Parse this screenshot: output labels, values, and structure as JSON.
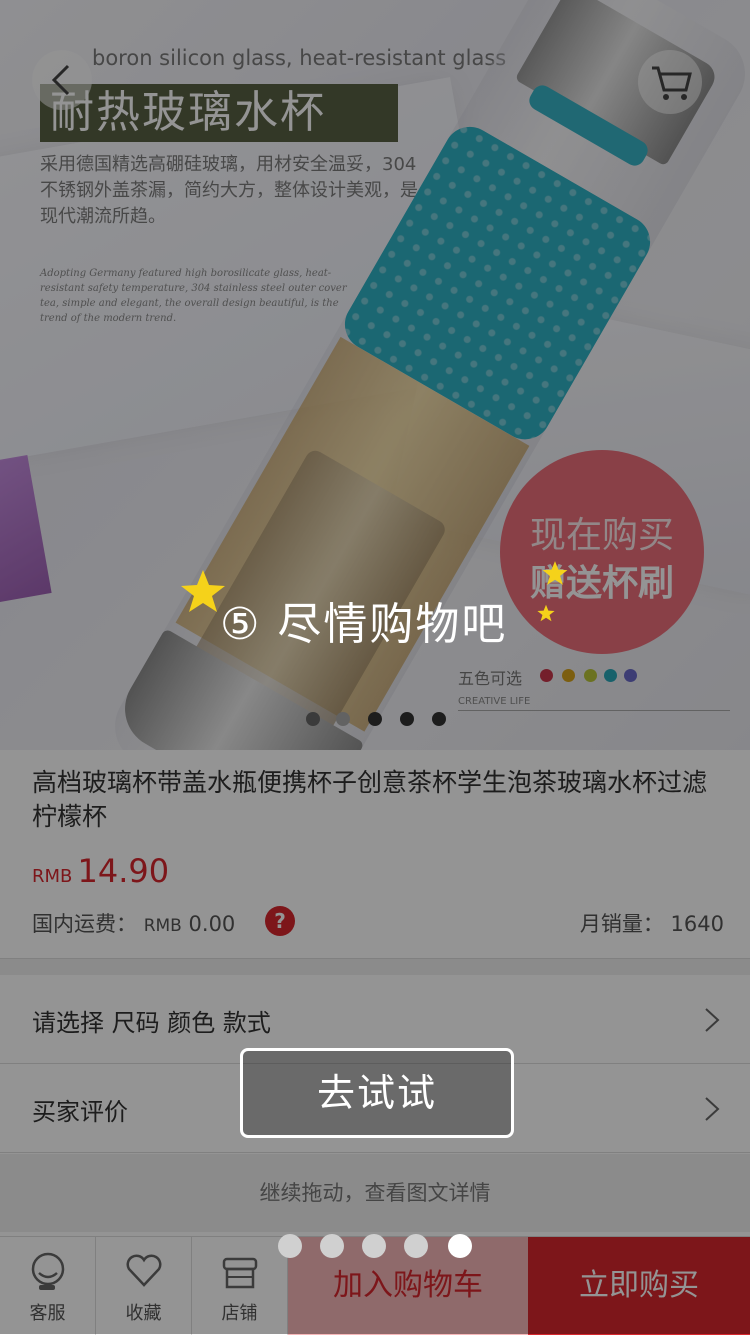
{
  "hero": {
    "en_heading": "boron silicon glass, heat-resistant glass",
    "cn_title": "耐热玻璃水杯",
    "description": "采用德国精选高硼硅玻璃，用材安全温妥，304不锈钢外盖茶漏，简约大方，整体设计美观，是现代潮流所趋。",
    "small_en": "Adopting Germany featured high borosilicate glass, heat-resistant safety temperature, 304 stainless steel outer cover tea, simple and elegant, the overall design beautiful, is the trend of the modern trend.",
    "promo_line1": "现在购买",
    "promo_line2": "赠送杯刷",
    "colors_label": "五色可选",
    "colors": [
      "#c8364a",
      "#d6a21b",
      "#b9c43a",
      "#2aa7b8",
      "#6a6ac8"
    ],
    "creative_label": "CREATIVE LIFE",
    "carousel_count": 5
  },
  "product": {
    "title": "高档玻璃杯带盖水瓶便携杯子创意茶杯学生泡茶玻璃水杯过滤柠檬杯",
    "price_currency": "RMB",
    "price": "14.90",
    "shipping_label": "国内运费：",
    "shipping_currency": "RMB",
    "shipping_value": "0.00",
    "help_mark": "?",
    "sales_label": "月销量：",
    "sales_value": "1640"
  },
  "rows": {
    "spec": "请选择 尺码 颜色 款式",
    "reviews": "买家评价"
  },
  "detail_hint": "继续拖动，查看图文详情",
  "bottom_bar": {
    "service": "客服",
    "favorite": "收藏",
    "store": "店铺",
    "add_cart": "加入购物车",
    "buy_now": "立即购买"
  },
  "guide": {
    "step_text": "⑤ 尽情购物吧",
    "try_button": "去试试",
    "total_steps": 5,
    "current_step": 5
  },
  "accent": "#d8272e"
}
